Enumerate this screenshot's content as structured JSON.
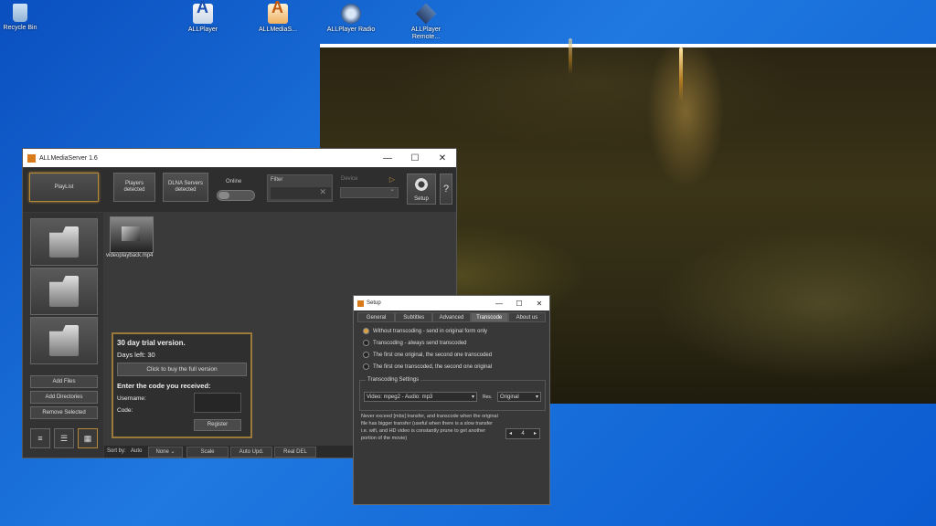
{
  "desktop": {
    "icons": [
      {
        "label": "Recycle Bin"
      },
      {
        "label": "ALLPlayer"
      },
      {
        "label": "ALLMediaS..."
      },
      {
        "label": "ALLPlayer Radio"
      },
      {
        "label": "ALLPlayer Remote..."
      }
    ]
  },
  "app": {
    "title": "ALLMediaServer 1.6",
    "win_min": "—",
    "win_max": "☐",
    "win_close": "✕",
    "toolbar": {
      "playlist": "PlayList",
      "players": "Players detected",
      "dlna": "DLNA Servers detected",
      "online": "Online",
      "filter": "Filter",
      "filter_clear": "✕",
      "device": "Device",
      "setup": "Setup",
      "help": "?"
    },
    "left": {
      "add_files": "Add Files",
      "add_dirs": "Add Directories",
      "remove": "Remove Selected",
      "view_list": "≡",
      "view_detail": "☰",
      "view_grid": "▦"
    },
    "media": [
      {
        "label": "videoplayback.mp4"
      }
    ],
    "trial": {
      "heading": "30 day trial version.",
      "days_left": "Days left: 30",
      "buy": "Click to buy the full version",
      "code_heading": "Enter the code you received:",
      "username": "Username:",
      "code": "Code:",
      "register": "Register"
    },
    "sortbar": {
      "sort_by": "Sort by:",
      "auto": "Auto",
      "none": "None",
      "scale": "Scale",
      "auto_upd": "Auto Upd.",
      "real_del": "Real DEL"
    }
  },
  "setup": {
    "title": "Setup",
    "win_min": "—",
    "win_max": "☐",
    "win_close": "✕",
    "tabs": [
      "General",
      "Subtitles",
      "Advanced",
      "Transcode",
      "About us"
    ],
    "active_tab": "Transcode",
    "options": [
      {
        "label": "Without transcoding - send in original form only",
        "selected": true
      },
      {
        "label": "Transcoding - always send transcoded",
        "selected": false
      },
      {
        "label": "The first one original, the second one transcoded",
        "selected": false
      },
      {
        "label": "The first one transcoded, the second one original",
        "selected": false
      }
    ],
    "transcoding_settings": "Transcoding Settings",
    "video_select": "Video: mpeg2 - Audio: mp3",
    "res_label": "Res.",
    "res_select": "Original",
    "note": "Never exceed [mbs] transfer, and transcode when the original file has bigger transfer (useful when there is a slow transfer i.e. wifi, and HD video is constantly prune to get another portion of the movie)",
    "spin_value": "4"
  }
}
